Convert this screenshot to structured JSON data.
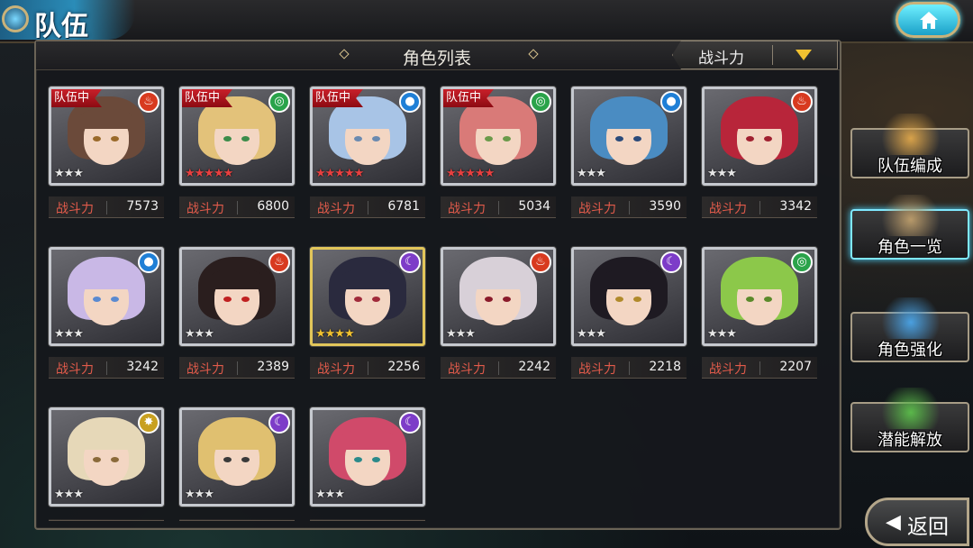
{
  "page_title": "队伍",
  "list_title": "角色列表",
  "sort": {
    "label": "战斗力"
  },
  "power_label": "战斗力",
  "in_team_label": "队伍中",
  "element_colors": {
    "fire": "#d83a1f",
    "wind": "#2aa34a",
    "water": "#1f7fd6",
    "dark": "#7d3cc8",
    "light": "#c8a020"
  },
  "characters": [
    {
      "in_team": true,
      "element": "fire",
      "element_icon": "flame-icon",
      "stars": 3,
      "star_color": "silver",
      "power": "7573",
      "hair": "#6b4a3a",
      "eyes": "#9a6a2a",
      "frame": "silver"
    },
    {
      "in_team": true,
      "element": "wind",
      "element_icon": "swirl-icon",
      "stars": 5,
      "star_color": "red",
      "power": "6800",
      "hair": "#e3c27a",
      "eyes": "#3c8c4a",
      "frame": "silver"
    },
    {
      "in_team": true,
      "element": "water",
      "element_icon": "drop-icon",
      "stars": 5,
      "star_color": "red",
      "power": "6781",
      "hair": "#a8c4e6",
      "eyes": "#6a8ab0",
      "frame": "silver"
    },
    {
      "in_team": true,
      "element": "wind",
      "element_icon": "swirl-icon",
      "stars": 5,
      "star_color": "red",
      "power": "5034",
      "hair": "#d97a78",
      "eyes": "#6a9a4a",
      "frame": "silver"
    },
    {
      "in_team": false,
      "element": "water",
      "element_icon": "drop-icon",
      "stars": 3,
      "star_color": "silver",
      "power": "3590",
      "hair": "#4a8cc2",
      "eyes": "#2a4a7a",
      "frame": "silver"
    },
    {
      "in_team": false,
      "element": "fire",
      "element_icon": "flame-icon",
      "stars": 3,
      "star_color": "silver",
      "power": "3342",
      "hair": "#b8253a",
      "eyes": "#a02030",
      "frame": "silver"
    },
    {
      "in_team": false,
      "element": "water",
      "element_icon": "drop-icon",
      "stars": 3,
      "star_color": "silver",
      "power": "3242",
      "hair": "#c9b8e6",
      "eyes": "#5a8ad0",
      "frame": "silver"
    },
    {
      "in_team": false,
      "element": "fire",
      "element_icon": "flame-icon",
      "stars": 3,
      "star_color": "silver",
      "power": "2389",
      "hair": "#2a1e1e",
      "eyes": "#c02020",
      "frame": "silver"
    },
    {
      "in_team": false,
      "element": "dark",
      "element_icon": "moon-icon",
      "stars": 4,
      "star_color": "gold",
      "power": "2256",
      "hair": "#2a2a3e",
      "eyes": "#a02a3a",
      "frame": "gold"
    },
    {
      "in_team": false,
      "element": "fire",
      "element_icon": "flame-icon",
      "stars": 3,
      "star_color": "silver",
      "power": "2242",
      "hair": "#d8d0d8",
      "eyes": "#8a1a2a",
      "frame": "silver"
    },
    {
      "in_team": false,
      "element": "dark",
      "element_icon": "moon-icon",
      "stars": 3,
      "star_color": "silver",
      "power": "2218",
      "hair": "#1e1a22",
      "eyes": "#b08a2a",
      "frame": "silver"
    },
    {
      "in_team": false,
      "element": "wind",
      "element_icon": "swirl-icon",
      "stars": 3,
      "star_color": "silver",
      "power": "2207",
      "hair": "#8cc84a",
      "eyes": "#5a8a2a",
      "frame": "silver"
    },
    {
      "in_team": false,
      "element": "light",
      "element_icon": "sun-icon",
      "stars": 3,
      "star_color": "silver",
      "power": "",
      "hair": "#e6d8b8",
      "eyes": "#8a6a3a",
      "frame": "silver"
    },
    {
      "in_team": false,
      "element": "dark",
      "element_icon": "moon-icon",
      "stars": 3,
      "star_color": "silver",
      "power": "",
      "hair": "#e0c070",
      "eyes": "#3a3a3a",
      "frame": "silver"
    },
    {
      "in_team": false,
      "element": "dark",
      "element_icon": "moon-icon",
      "stars": 3,
      "star_color": "silver",
      "power": "",
      "hair": "#d04a6a",
      "eyes": "#2a8a8a",
      "frame": "silver"
    }
  ],
  "side_menu": [
    {
      "label": "队伍编成",
      "icon": "party-members-icon",
      "active": false,
      "icon_color": "#d8a24a"
    },
    {
      "label": "角色一览",
      "icon": "character-book-icon",
      "active": true,
      "icon_color": "#b89a6a"
    },
    {
      "label": "角色强化",
      "icon": "enhance-crystal-icon",
      "active": false,
      "icon_color": "#4aa0e0"
    },
    {
      "label": "潜能解放",
      "icon": "potential-orb-icon",
      "active": false,
      "icon_color": "#5ab84a"
    }
  ],
  "back_button": {
    "label": "返回"
  }
}
